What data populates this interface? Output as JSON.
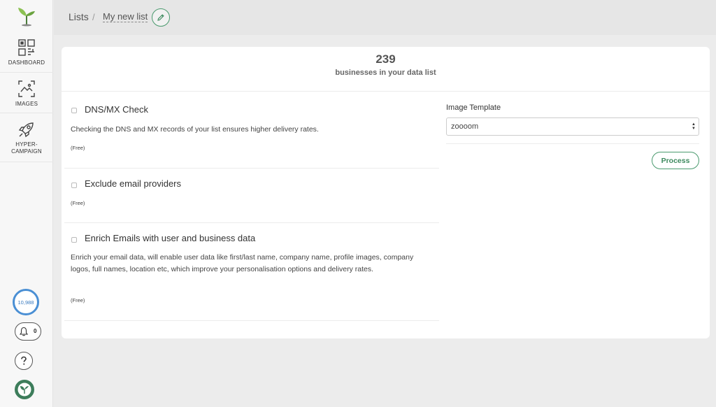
{
  "sidebar": {
    "items": [
      {
        "label": "DASHBOARD",
        "icon": "dashboard-icon"
      },
      {
        "label": "IMAGES",
        "icon": "images-icon"
      },
      {
        "label": "HYPER-",
        "label2": "CAMPAIGN",
        "icon": "rocket-icon"
      }
    ],
    "credits": "10,988",
    "notifications": "0"
  },
  "breadcrumb": {
    "root": "Lists",
    "separator": "/",
    "current": "My new list"
  },
  "summary": {
    "count": "239",
    "label": "businesses in your data list"
  },
  "options": [
    {
      "title": "DNS/MX Check",
      "description": "Checking the DNS and MX records of your list ensures higher delivery rates.",
      "price": "(Free)"
    },
    {
      "title": "Exclude email providers",
      "description": "",
      "price": "(Free)"
    },
    {
      "title": "Enrich Emails with user and business data",
      "description": "Enrich your email data, will enable user data like first/last name, company name, profile images, company logos, full names, location etc, which improve your personalisation options and delivery rates.",
      "price": "(Free)"
    }
  ],
  "template": {
    "label": "Image Template",
    "selected": "zoooom"
  },
  "actions": {
    "process": "Process"
  },
  "colors": {
    "accent": "#3d8a5e",
    "credits_ring": "#4a8fd4"
  }
}
